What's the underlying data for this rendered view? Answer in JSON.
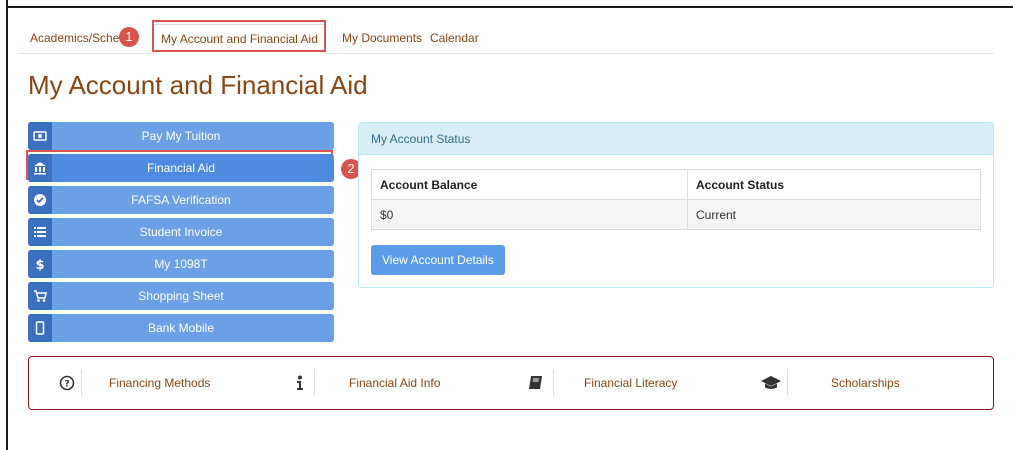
{
  "nav": {
    "tabs": [
      {
        "label": "Academics/Schedule"
      },
      {
        "label": "My Account and Financial Aid"
      },
      {
        "label": "My Documents"
      },
      {
        "label": "Calendar"
      }
    ]
  },
  "callouts": [
    "1",
    "2"
  ],
  "page": {
    "title": "My Account and Financial Aid"
  },
  "menu": [
    {
      "label": "Pay My Tuition",
      "icon": "money-icon"
    },
    {
      "label": "Financial Aid",
      "icon": "bank-icon"
    },
    {
      "label": "FAFSA Verification",
      "icon": "check-circle-icon"
    },
    {
      "label": "Student Invoice",
      "icon": "list-icon"
    },
    {
      "label": "My 1098T",
      "icon": "dollar-icon"
    },
    {
      "label": "Shopping Sheet",
      "icon": "cart-icon"
    },
    {
      "label": "Bank Mobile",
      "icon": "mobile-icon"
    }
  ],
  "account": {
    "panel_title": "My Account Status",
    "headers": [
      "Account Balance",
      "Account Status"
    ],
    "row": [
      "$0",
      "Current"
    ],
    "button_label": "View Account Details"
  },
  "links": [
    {
      "label": "Financing Methods",
      "icon": "question-circle-icon"
    },
    {
      "label": "Financial Aid Info",
      "icon": "info-icon"
    },
    {
      "label": "Financial Literacy",
      "icon": "book-icon"
    },
    {
      "label": "Scholarships",
      "icon": "graduation-cap-icon"
    }
  ],
  "colors": {
    "accent": "#8b4513",
    "button": "#6b9fe6",
    "callout": "#d9534f",
    "panel_head": "#d9edf7"
  }
}
